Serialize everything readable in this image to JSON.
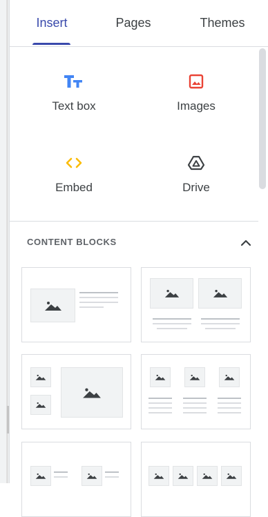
{
  "tabs": [
    {
      "label": "Insert",
      "active": true
    },
    {
      "label": "Pages",
      "active": false
    },
    {
      "label": "Themes",
      "active": false
    }
  ],
  "insert_items": [
    {
      "label": "Text box",
      "icon": "text-box-icon",
      "color": "#4285f4"
    },
    {
      "label": "Images",
      "icon": "image-icon",
      "color": "#ea4335"
    },
    {
      "label": "Embed",
      "icon": "embed-icon",
      "color": "#fbbc04"
    },
    {
      "label": "Drive",
      "icon": "drive-icon",
      "color": "#3c4043"
    }
  ],
  "content_blocks": {
    "header": "CONTENT BLOCKS",
    "collapse_icon": "chevron-up-icon",
    "layouts": [
      "image-left-text-right",
      "two-images-with-captions",
      "two-small-images-one-large",
      "three-images-with-captions",
      "image-text-pairs",
      "four-images"
    ]
  },
  "colors": {
    "accent": "#3949ab",
    "divider": "#dadce0",
    "placeholder": "#f1f3f4"
  }
}
